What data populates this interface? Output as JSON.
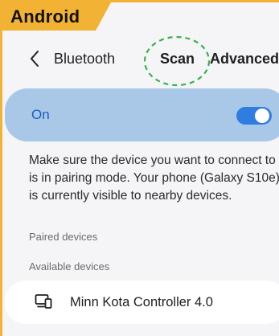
{
  "brand_badge": {
    "label": "Android"
  },
  "header": {
    "title": "Bluetooth",
    "scan_label": "Scan",
    "advanced_label": "Advanced",
    "icons": {
      "back": "chevron-left-icon",
      "highlight": "dashed-circle"
    }
  },
  "bluetooth_toggle": {
    "label": "On",
    "state": "on"
  },
  "description": "Make sure the device you want to connect to is in pairing mode. Your phone (Galaxy S10e) is currently visible to nearby devices.",
  "sections": {
    "paired": "Paired devices",
    "available": "Available devices"
  },
  "available_devices": [
    {
      "name": "Minn Kota Controller 4.0",
      "icon": "device-display-icon"
    }
  ],
  "colors": {
    "accent": "#f2b233",
    "toggle_card": "#a9c8e8",
    "toggle_active": "#2f7de1",
    "scan_highlight": "#35b34a",
    "background": "#f5f5f7"
  }
}
